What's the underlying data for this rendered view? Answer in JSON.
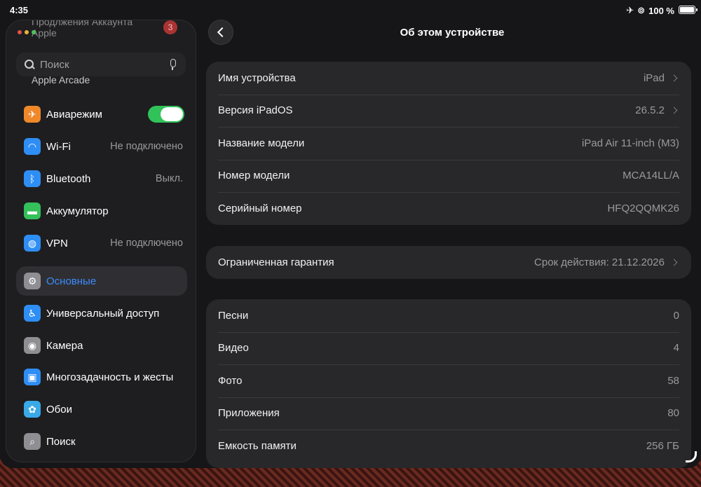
{
  "status": {
    "time": "4:35",
    "battery": "100 %"
  },
  "sidebar": {
    "ghost_top": "Продлжения Аккаунта",
    "ghost_top2": "Apple",
    "ghost_badge": "3",
    "ghost_arcade": "Apple Arcade",
    "search_placeholder": "Поиск",
    "items": [
      {
        "label": "Авиарежим",
        "icon": "airplane-icon",
        "color": "#f0882a",
        "toggle": true
      },
      {
        "label": "Wi-Fi",
        "icon": "wifi-icon",
        "color": "#2e8ef5",
        "value": "Не подключено"
      },
      {
        "label": "Bluetooth",
        "icon": "bluetooth-icon",
        "color": "#2e8ef5",
        "value": "Выкл."
      },
      {
        "label": "Аккумулятор",
        "icon": "battery-icon",
        "color": "#34c05a"
      },
      {
        "label": "VPN",
        "icon": "vpn-globe-icon",
        "color": "#2e8ef5",
        "value": "Не подключено"
      },
      {
        "label": "Основные",
        "icon": "gear-icon",
        "color": "#8e8e93",
        "active": true
      },
      {
        "label": "Универсальный доступ",
        "icon": "accessibility-icon",
        "color": "#2e8ef5"
      },
      {
        "label": "Камера",
        "icon": "camera-icon",
        "color": "#8e8e93"
      },
      {
        "label": "Многозадачность и жесты",
        "icon": "multitasking-icon",
        "color": "#2e8ef5"
      },
      {
        "label": "Обои",
        "icon": "wallpaper-flower-icon",
        "color": "#3aa9e8"
      },
      {
        "label": "Поиск",
        "icon": "search-icon",
        "color": "#8e8e93"
      }
    ]
  },
  "main": {
    "title": "Об этом устройстве",
    "group1": [
      {
        "label": "Имя устройства",
        "value": "iPad",
        "chevron": true
      },
      {
        "label": "Версия iPadOS",
        "value": "26.5.2",
        "chevron": true
      },
      {
        "label": "Название модели",
        "value": "iPad Air 11-inch (M3)"
      },
      {
        "label": "Номер модели",
        "value": "MCA14LL/A"
      },
      {
        "label": "Серийный номер",
        "value": "HFQ2QQMK26"
      }
    ],
    "group2": [
      {
        "label": "Ограниченная гарантия",
        "value": "Срок действия: 21.12.2026",
        "chevron": true
      }
    ],
    "group3": [
      {
        "label": "Песни",
        "value": "0"
      },
      {
        "label": "Видео",
        "value": "4"
      },
      {
        "label": "Фото",
        "value": "58"
      },
      {
        "label": "Приложения",
        "value": "80"
      },
      {
        "label": "Емкость памяти",
        "value": "256 ГБ"
      }
    ]
  }
}
